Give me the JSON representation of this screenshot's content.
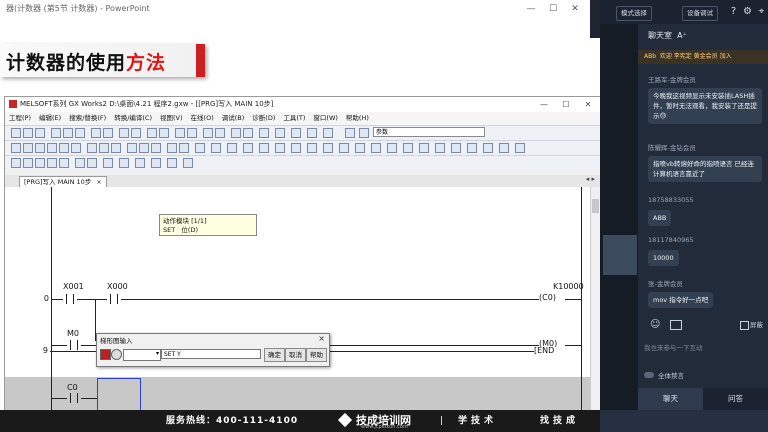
{
  "ppt": {
    "title": "器(计数器 (第5节 计数器) - PowerPoint",
    "win_min": "—",
    "win_max": "☐",
    "win_close": "✕"
  },
  "slide": {
    "title_main": "计数器的使用",
    "title_highlight": "方法"
  },
  "gx": {
    "title": "MELSOFT系列 GX Works2 D:\\桌面\\4.21 程序2.gxw - [[PRG]写入 MAIN 10步]",
    "menu": [
      "工程(P)",
      "编辑(E)",
      "搜索/替换(F)",
      "转换/编译(C)",
      "视图(V)",
      "在线(O)",
      "调试(B)",
      "诊断(D)",
      "工具(T)",
      "窗口(W)",
      "帮助(H)"
    ],
    "toolbar_combo": "参数",
    "tab_label": "[PRG]写入 MAIN 10步",
    "tab_close": "×",
    "tab_arrows": "◂ ▸",
    "steps": {
      "s0": "0",
      "s9": "9"
    },
    "devices": {
      "x001": "X001",
      "x000": "X000",
      "m0": "M0",
      "c0": "C0"
    },
    "coils": {
      "c0": "C0",
      "m0": "M0",
      "end": "END"
    },
    "k_value": "K10000",
    "tooltip": {
      "line1": "动作模块 [1/1]",
      "line2_a": "SET",
      "line2_b": "位(D)"
    }
  },
  "dialog": {
    "title": "梯形图输入",
    "close": "×",
    "input_value": "SET Y",
    "ok": "确定",
    "cancel": "取消",
    "help": "帮助"
  },
  "banner": {
    "hotline": "服务热线：400-111-4100",
    "logo": "技成培训网",
    "logo_sub": "www.jcpeixun.com",
    "sep": "|",
    "motto1": "学技术",
    "motto2": "找技成"
  },
  "side": {
    "mode_button": "模式选择",
    "device_button": "设备调试",
    "help_icon": "?",
    "settings_icon": "⚙",
    "pin_icon": "⌖",
    "close_icon": "✕",
    "chat_title": "聊天室",
    "font_toggle": "A⁺",
    "notice_user": "ABb",
    "notice": "欢迎 李宪定 黄金会员 加入",
    "messages": [
      {
        "name": "王路军-金牌会员",
        "text": "今晚我这视频显示未安装插LASH插件，暂时无法观看，我安装了还是提示😓"
      },
      {
        "name": "陈耀辉-金钻会员",
        "text": "指喷vb转熔好命的指喷语言 已经连计算机语言靠近了"
      },
      {
        "name": "18758833055",
        "text": "ABB"
      },
      {
        "name": "18117840965",
        "text": "10000"
      },
      {
        "name": "张-金牌会员",
        "text": "mov 指令好一点吧"
      }
    ],
    "screen_toggle": "屏蔽",
    "input_placeholder": "我也来参与一下互动",
    "mute_label": "全体禁言",
    "tab_chat": "聊天",
    "tab_qa": "问答"
  }
}
